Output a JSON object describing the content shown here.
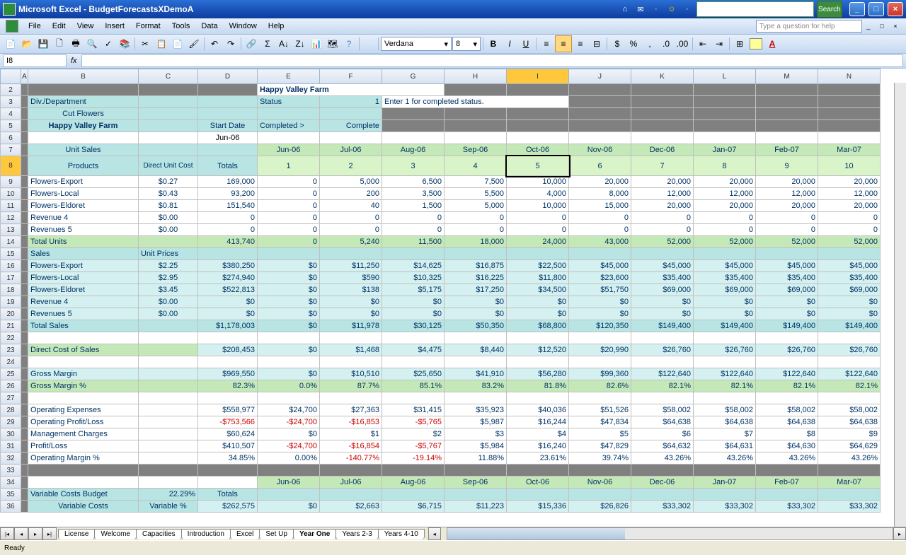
{
  "title": "Microsoft Excel - BudgetForecastsXDemoA",
  "menu": [
    "File",
    "Edit",
    "View",
    "Insert",
    "Format",
    "Tools",
    "Data",
    "Window",
    "Help"
  ],
  "qbox": "Type a question for help",
  "search_btn": "Search",
  "font": "Verdana",
  "fontsize": "8",
  "cellref": "I8",
  "cols": [
    "A",
    "B",
    "C",
    "D",
    "E",
    "F",
    "G",
    "H",
    "I",
    "J",
    "K",
    "L",
    "M",
    "N"
  ],
  "r2": {
    "E": "Happy Valley Farm"
  },
  "r3": {
    "B": "Div./Department",
    "E": "Status",
    "F": "1",
    "G": "Enter 1 for completed status."
  },
  "r4": {
    "B": "Cut Flowers"
  },
  "r5": {
    "B": "Happy Valley Farm",
    "D": "Start Date",
    "E": "Completed >",
    "F": "Complete"
  },
  "r6": {
    "D": "Jun-06"
  },
  "r7": {
    "B": "Unit Sales",
    "E": "Jun-06",
    "F": "Jul-06",
    "G": "Aug-06",
    "H": "Sep-06",
    "I": "Oct-06",
    "J": "Nov-06",
    "K": "Dec-06",
    "L": "Jan-07",
    "M": "Feb-07",
    "N": "Mar-07"
  },
  "r8": {
    "B": "Products",
    "C": "Direct Unit Cost",
    "D": "Totals",
    "E": "1",
    "F": "2",
    "G": "3",
    "H": "4",
    "I": "5",
    "J": "6",
    "K": "7",
    "L": "8",
    "M": "9",
    "N": "10"
  },
  "r9": {
    "B": "Flowers-Export",
    "C": "$0.27",
    "D": "169,000",
    "E": "0",
    "F": "5,000",
    "G": "6,500",
    "H": "7,500",
    "I": "10,000",
    "J": "20,000",
    "K": "20,000",
    "L": "20,000",
    "M": "20,000",
    "N": "20,000"
  },
  "r10": {
    "B": "Flowers-Local",
    "C": "$0.43",
    "D": "93,200",
    "E": "0",
    "F": "200",
    "G": "3,500",
    "H": "5,500",
    "I": "4,000",
    "J": "8,000",
    "K": "12,000",
    "L": "12,000",
    "M": "12,000",
    "N": "12,000"
  },
  "r11": {
    "B": "Flowers-Eldoret",
    "C": "$0.81",
    "D": "151,540",
    "E": "0",
    "F": "40",
    "G": "1,500",
    "H": "5,000",
    "I": "10,000",
    "J": "15,000",
    "K": "20,000",
    "L": "20,000",
    "M": "20,000",
    "N": "20,000"
  },
  "r12": {
    "B": "Revenue 4",
    "C": "$0.00",
    "D": "0",
    "E": "0",
    "F": "0",
    "G": "0",
    "H": "0",
    "I": "0",
    "J": "0",
    "K": "0",
    "L": "0",
    "M": "0",
    "N": "0"
  },
  "r13": {
    "B": "Revenues 5",
    "C": "$0.00",
    "D": "0",
    "E": "0",
    "F": "0",
    "G": "0",
    "H": "0",
    "I": "0",
    "J": "0",
    "K": "0",
    "L": "0",
    "M": "0",
    "N": "0"
  },
  "r14": {
    "B": "Total Units",
    "D": "413,740",
    "E": "0",
    "F": "5,240",
    "G": "11,500",
    "H": "18,000",
    "I": "24,000",
    "J": "43,000",
    "K": "52,000",
    "L": "52,000",
    "M": "52,000",
    "N": "52,000"
  },
  "r15": {
    "B": "Sales",
    "C": "Unit Prices"
  },
  "r16": {
    "B": "Flowers-Export",
    "C": "$2.25",
    "D": "$380,250",
    "E": "$0",
    "F": "$11,250",
    "G": "$14,625",
    "H": "$16,875",
    "I": "$22,500",
    "J": "$45,000",
    "K": "$45,000",
    "L": "$45,000",
    "M": "$45,000",
    "N": "$45,000"
  },
  "r17": {
    "B": "Flowers-Local",
    "C": "$2.95",
    "D": "$274,940",
    "E": "$0",
    "F": "$590",
    "G": "$10,325",
    "H": "$16,225",
    "I": "$11,800",
    "J": "$23,600",
    "K": "$35,400",
    "L": "$35,400",
    "M": "$35,400",
    "N": "$35,400"
  },
  "r18": {
    "B": "Flowers-Eldoret",
    "C": "$3.45",
    "D": "$522,813",
    "E": "$0",
    "F": "$138",
    "G": "$5,175",
    "H": "$17,250",
    "I": "$34,500",
    "J": "$51,750",
    "K": "$69,000",
    "L": "$69,000",
    "M": "$69,000",
    "N": "$69,000"
  },
  "r19": {
    "B": "Revenue 4",
    "C": "$0.00",
    "D": "$0",
    "E": "$0",
    "F": "$0",
    "G": "$0",
    "H": "$0",
    "I": "$0",
    "J": "$0",
    "K": "$0",
    "L": "$0",
    "M": "$0",
    "N": "$0"
  },
  "r20": {
    "B": "Revenues 5",
    "C": "$0.00",
    "D": "$0",
    "E": "$0",
    "F": "$0",
    "G": "$0",
    "H": "$0",
    "I": "$0",
    "J": "$0",
    "K": "$0",
    "L": "$0",
    "M": "$0",
    "N": "$0"
  },
  "r21": {
    "B": "Total Sales",
    "D": "$1,178,003",
    "E": "$0",
    "F": "$11,978",
    "G": "$30,125",
    "H": "$50,350",
    "I": "$68,800",
    "J": "$120,350",
    "K": "$149,400",
    "L": "$149,400",
    "M": "$149,400",
    "N": "$149,400"
  },
  "r23": {
    "B": "Direct Cost of Sales",
    "D": "$208,453",
    "E": "$0",
    "F": "$1,468",
    "G": "$4,475",
    "H": "$8,440",
    "I": "$12,520",
    "J": "$20,990",
    "K": "$26,760",
    "L": "$26,760",
    "M": "$26,760",
    "N": "$26,760"
  },
  "r25": {
    "B": "Gross Margin",
    "D": "$969,550",
    "E": "$0",
    "F": "$10,510",
    "G": "$25,650",
    "H": "$41,910",
    "I": "$56,280",
    "J": "$99,360",
    "K": "$122,640",
    "L": "$122,640",
    "M": "$122,640",
    "N": "$122,640"
  },
  "r26": {
    "B": "Gross Margin %",
    "D": "82.3%",
    "E": "0.0%",
    "F": "87.7%",
    "G": "85.1%",
    "H": "83.2%",
    "I": "81.8%",
    "J": "82.6%",
    "K": "82.1%",
    "L": "82.1%",
    "M": "82.1%",
    "N": "82.1%"
  },
  "r28": {
    "B": "Operating Expenses",
    "D": "$558,977",
    "E": "$24,700",
    "F": "$27,363",
    "G": "$31,415",
    "H": "$35,923",
    "I": "$40,036",
    "J": "$51,526",
    "K": "$58,002",
    "L": "$58,002",
    "M": "$58,002",
    "N": "$58,002"
  },
  "r29": {
    "B": "Operating Profit/Loss",
    "D": "-$753,566",
    "E": "-$24,700",
    "F": "-$16,853",
    "G": "-$5,765",
    "H": "$5,987",
    "I": "$16,244",
    "J": "$47,834",
    "K": "$64,638",
    "L": "$64,638",
    "M": "$64,638",
    "N": "$64,638"
  },
  "r30": {
    "B": "Management Charges",
    "D": "$60,624",
    "E": "$0",
    "F": "$1",
    "G": "$2",
    "H": "$3",
    "I": "$4",
    "J": "$5",
    "K": "$6",
    "L": "$7",
    "M": "$8",
    "N": "$9"
  },
  "r31": {
    "B": "Profit/Loss",
    "D": "$410,507",
    "E": "-$24,700",
    "F": "-$16,854",
    "G": "-$5,767",
    "H": "$5,984",
    "I": "$16,240",
    "J": "$47,829",
    "K": "$64,632",
    "L": "$64,631",
    "M": "$64,630",
    "N": "$64,629"
  },
  "r32": {
    "B": "Operating Margin %",
    "D": "34.85%",
    "E": "0.00%",
    "F": "-140.77%",
    "G": "-19.14%",
    "H": "11.88%",
    "I": "23.61%",
    "J": "39.74%",
    "K": "43.26%",
    "L": "43.26%",
    "M": "43.26%",
    "N": "43.26%"
  },
  "r34": {
    "E": "Jun-06",
    "F": "Jul-06",
    "G": "Aug-06",
    "H": "Sep-06",
    "I": "Oct-06",
    "J": "Nov-06",
    "K": "Dec-06",
    "L": "Jan-07",
    "M": "Feb-07",
    "N": "Mar-07"
  },
  "r35": {
    "B": "Variable Costs Budget",
    "C": "22.29%",
    "D": "Totals"
  },
  "r36": {
    "B": "Variable Costs",
    "C": "Variable %",
    "D": "$262,575",
    "E": "$0",
    "F": "$2,663",
    "G": "$6,715",
    "H": "$11,223",
    "I": "$15,336",
    "J": "$26,826",
    "K": "$33,302",
    "L": "$33,302",
    "M": "$33,302",
    "N": "$33,302"
  },
  "tabs": [
    "License",
    "Welcome",
    "Capacities",
    "Introduction",
    "Excel",
    "Set Up",
    "Year One",
    "Years 2-3",
    "Years 4-10"
  ],
  "active_tab": "Year One",
  "status": "Ready"
}
